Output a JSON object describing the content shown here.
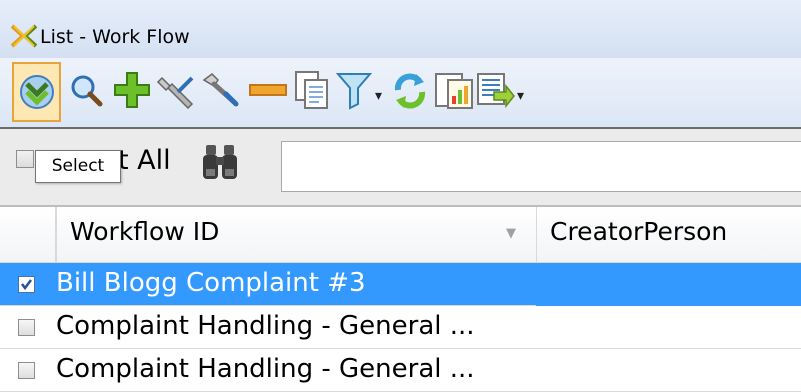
{
  "window": {
    "title": "List - Work Flow"
  },
  "toolbar": {
    "buttons": [
      {
        "name": "select-check-icon"
      },
      {
        "name": "search-magnifier-icon"
      },
      {
        "name": "add-plus-icon"
      },
      {
        "name": "edit-wrench-icon"
      },
      {
        "name": "delete-minus-icon"
      },
      {
        "name": "copy-icon"
      },
      {
        "name": "filter-funnel-icon"
      },
      {
        "name": "refresh-icon"
      },
      {
        "name": "chart-report-icon"
      },
      {
        "name": "export-icon"
      }
    ],
    "accent": "#e7a43a"
  },
  "filter": {
    "select_all_label_visible": "t All",
    "tooltip": "Select",
    "search_value": ""
  },
  "grid": {
    "columns": [
      "Workflow ID",
      "CreatorPerson"
    ],
    "rows": [
      {
        "workflow_id": "Bill Blogg Complaint #3",
        "creator": "",
        "checked": true,
        "selected": true
      },
      {
        "workflow_id": "Complaint Handling - General ...",
        "creator": "",
        "checked": false,
        "selected": false
      },
      {
        "workflow_id": "Complaint Handling - General ...",
        "creator": "",
        "checked": false,
        "selected": false
      }
    ],
    "selection_color": "#3399ff"
  }
}
